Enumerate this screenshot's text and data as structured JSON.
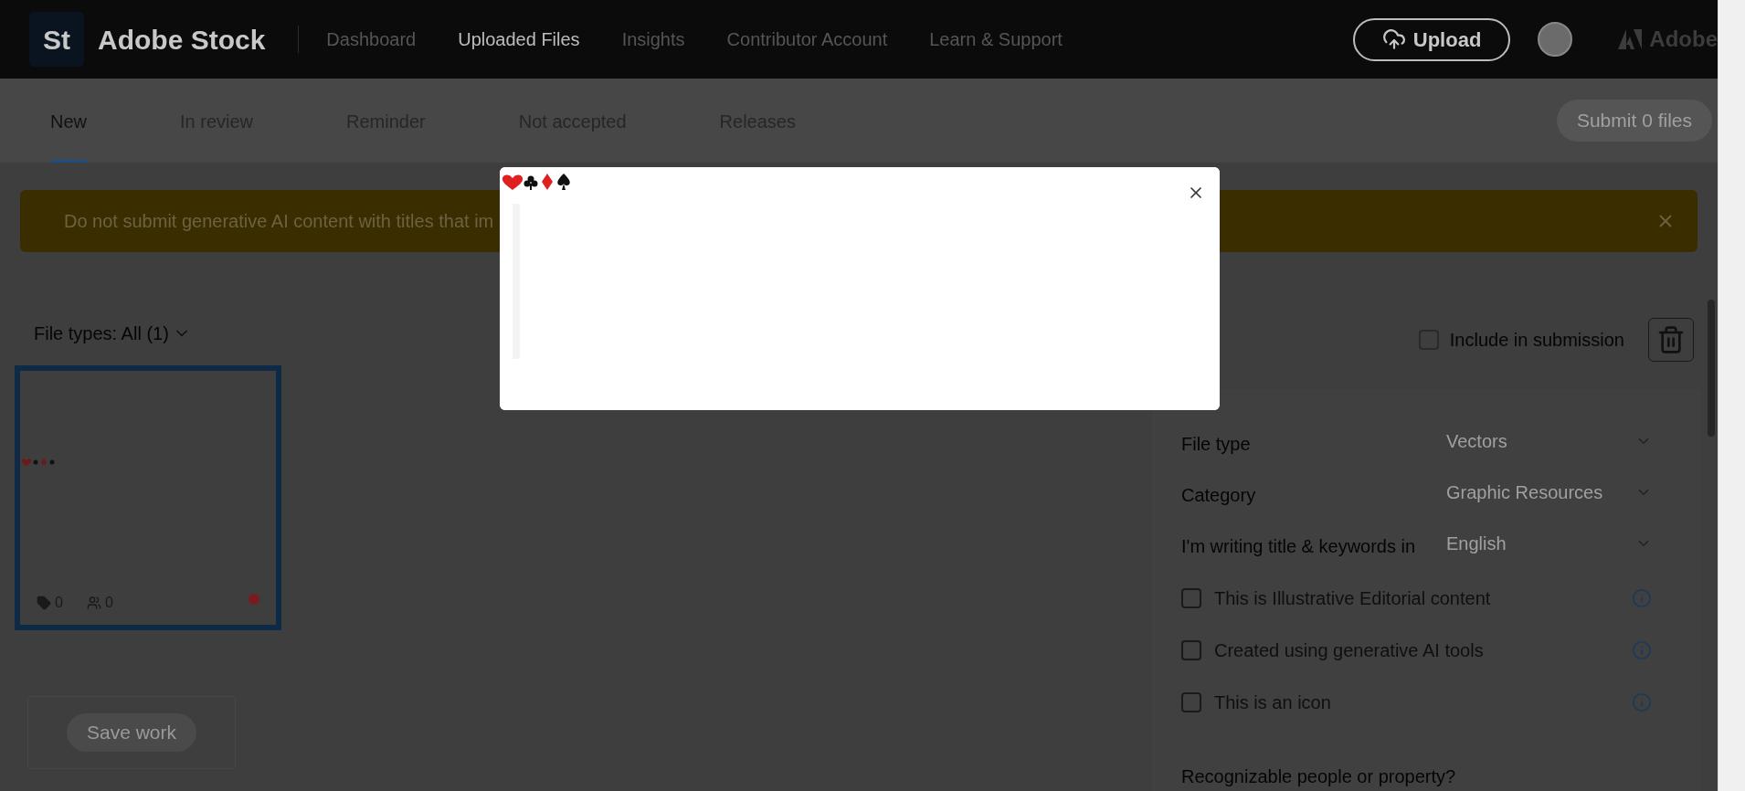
{
  "header": {
    "logo_mark": "St",
    "brand": "Adobe Stock",
    "nav": [
      {
        "label": "Dashboard",
        "selected": false
      },
      {
        "label": "Uploaded Files",
        "selected": true
      },
      {
        "label": "Insights",
        "selected": false
      },
      {
        "label": "Contributor Account",
        "selected": false
      },
      {
        "label": "Learn & Support",
        "selected": false
      }
    ],
    "upload_button": "Upload",
    "adobe_label": "Adobe"
  },
  "tabs": [
    {
      "label": "New",
      "selected": true
    },
    {
      "label": "In review",
      "selected": false
    },
    {
      "label": "Reminder",
      "selected": false
    },
    {
      "label": "Not accepted",
      "selected": false
    },
    {
      "label": "Releases",
      "selected": false
    }
  ],
  "submit_button": {
    "label": "Submit 0 files",
    "disabled": true
  },
  "banner": {
    "text": "Do not submit generative AI content with titles that im"
  },
  "filter": {
    "label": "File types: All (1)"
  },
  "file_card": {
    "selected": true,
    "keywords": "0",
    "people": "0"
  },
  "save_button": {
    "label": "Save work",
    "disabled": true
  },
  "details": {
    "include": {
      "label": "Include in submission",
      "checked": false
    },
    "fields": [
      {
        "label": "File type",
        "value": "Vectors"
      },
      {
        "label": "Category",
        "value": "Graphic Resources"
      },
      {
        "label": "I'm writing title & keywords in",
        "value": "English"
      }
    ],
    "options": [
      {
        "label": "This is Illustrative Editorial content",
        "checked": false
      },
      {
        "label": "Created using generative AI tools",
        "checked": false
      },
      {
        "label": "This is an icon",
        "checked": false
      }
    ],
    "recognizable_label": "Recognizable people or property?"
  }
}
